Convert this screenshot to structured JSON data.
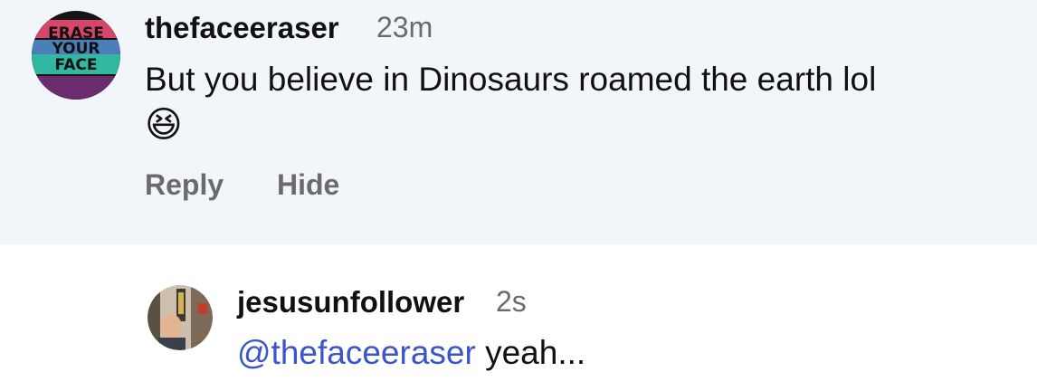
{
  "comments": [
    {
      "username": "thefaceeraser",
      "time": "23m",
      "text": "But you believe in Dinosaurs roamed the earth lol",
      "emoji": "😆",
      "avatar": {
        "text_line1": "ERASE",
        "text_line2": "YOUR",
        "text_line3": "FACE"
      },
      "actions": {
        "reply": "Reply",
        "hide": "Hide"
      }
    },
    {
      "username": "jesusunfollower",
      "time": "2s",
      "mention": "@thefaceeraser",
      "text": "yeah..."
    }
  ]
}
